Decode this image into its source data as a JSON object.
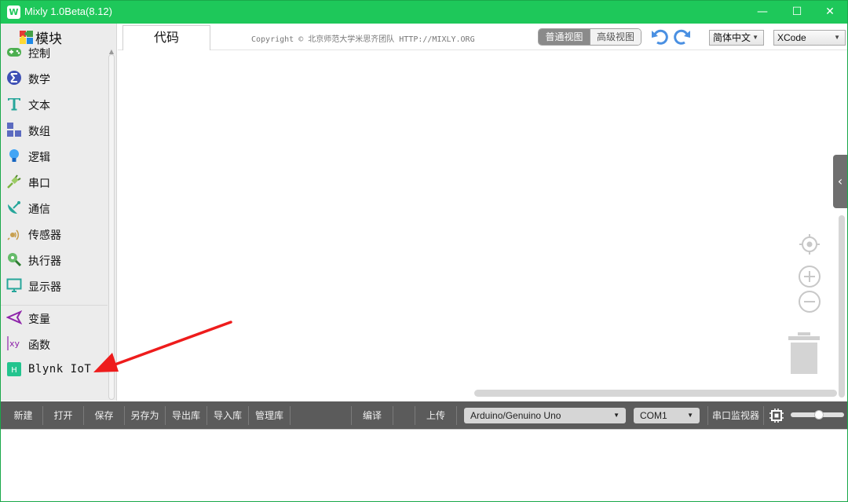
{
  "window": {
    "title": "Mixly 1.0Beta(8.12)",
    "app_icon_letter": "W",
    "minimize": "—",
    "maximize": "☐",
    "close": "✕"
  },
  "sidebar": {
    "header_label": "模块",
    "items": [
      {
        "label": "控制",
        "icon": "gamepad-icon"
      },
      {
        "label": "数学",
        "icon": "sigma-icon"
      },
      {
        "label": "文本",
        "icon": "text-t-icon"
      },
      {
        "label": "数组",
        "icon": "array-blocks-icon"
      },
      {
        "label": "逻辑",
        "icon": "lightbulb-icon"
      },
      {
        "label": "串口",
        "icon": "plug-icon"
      },
      {
        "label": "通信",
        "icon": "satellite-dish-icon"
      },
      {
        "label": "传感器",
        "icon": "sensor-icon"
      },
      {
        "label": "执行器",
        "icon": "actuator-icon"
      },
      {
        "label": "显示器",
        "icon": "monitor-icon"
      },
      {
        "label": "变量",
        "icon": "variable-icon"
      },
      {
        "label": "函数",
        "icon": "function-xy-icon"
      },
      {
        "label": "Blynk IoT",
        "icon": "blynk-icon"
      }
    ]
  },
  "header": {
    "code_tab": "代码",
    "copyright": "Copyright © 北京师范大学米思齐团队 HTTP://MIXLY.ORG",
    "view_normal": "普通视图",
    "view_advanced": "高级视图",
    "language": "简体中文",
    "theme": "XCode"
  },
  "toolbar": {
    "new": "新建",
    "open": "打开",
    "save": "保存",
    "save_as": "另存为",
    "export_lib": "导出库",
    "import_lib": "导入库",
    "manage_lib": "管理库",
    "compile": "编译",
    "upload": "上传",
    "board": "Arduino/Genuino Uno",
    "port": "COM1",
    "serial_monitor": "串口监视器"
  },
  "colors": {
    "titlebar": "#1ec85a",
    "toolbar": "#5b5b5b",
    "annotation": "#ee1c1c"
  }
}
